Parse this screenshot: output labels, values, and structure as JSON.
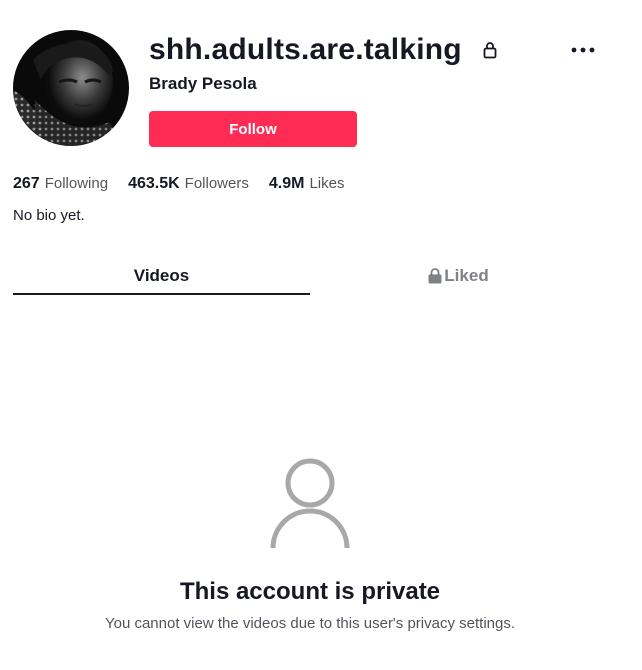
{
  "profile": {
    "username": "shh.adults.are.talking",
    "display_name": "Brady Pesola",
    "follow_label": "Follow",
    "bio": "No bio yet.",
    "avatar_icon": "profile-photo",
    "private_lock_icon": "lock-icon",
    "more_icon": "more-horizontal-icon"
  },
  "stats": [
    {
      "value": "267",
      "label": "Following"
    },
    {
      "value": "463.5K",
      "label": "Followers"
    },
    {
      "value": "4.9M",
      "label": "Likes"
    }
  ],
  "tabs": [
    {
      "label": "Videos",
      "active": true
    },
    {
      "label": "Liked",
      "active": false,
      "icon": "lock-icon"
    }
  ],
  "private_notice": {
    "icon": "user-icon",
    "title": "This account is private",
    "description": "You cannot view the videos due to this user's privacy settings."
  },
  "colors": {
    "accent": "#fe2c55",
    "text_primary": "#161823",
    "icon_gray": "#a8a8a8"
  }
}
